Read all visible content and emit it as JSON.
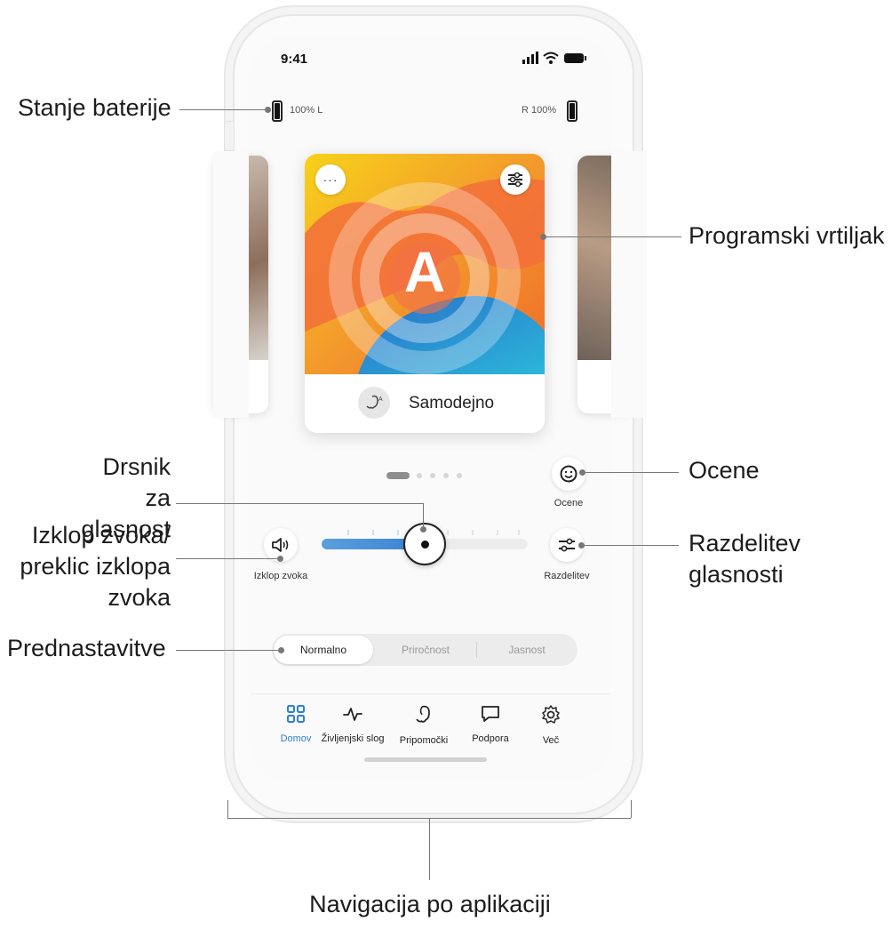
{
  "annotations": {
    "battery": "Stanje baterije",
    "carousel": "Programski vrtiljak",
    "ratings": "Ocene",
    "volume_slider": [
      "Drsnik za",
      "glasnost"
    ],
    "mute": [
      "Izklop zvoka/",
      "preklic izklopa",
      "zvoka"
    ],
    "split": [
      "Razdelitev",
      "glasnosti"
    ],
    "presets": "Prednastavitve",
    "navigation": "Navigacija po aplikaciji"
  },
  "status_bar": {
    "time": "9:41"
  },
  "battery": {
    "left_label": "100% L",
    "right_label": "R 100%"
  },
  "program": {
    "card_letter": "A",
    "name": "Samodejno",
    "page_count": 5,
    "active_page": 1
  },
  "controls": {
    "ratings_label": "Ocene",
    "mute_label": "Izklop zvoka",
    "split_label": "Razdelitev",
    "volume_level": 0.5
  },
  "presets": {
    "items": [
      "Normalno",
      "Priročnost",
      "Jasnost"
    ],
    "selected": "Normalno"
  },
  "nav": {
    "items": [
      {
        "label": "Domov",
        "icon": "grid-icon",
        "active": true
      },
      {
        "label": "Življenjski slog",
        "icon": "activity-icon",
        "active": false
      },
      {
        "label": "Pripomočki",
        "icon": "hearing-aid-icon",
        "active": false
      },
      {
        "label": "Podpora",
        "icon": "chat-icon",
        "active": false
      },
      {
        "label": "Več",
        "icon": "gear-icon",
        "active": false
      }
    ]
  },
  "colors": {
    "accent": "#2f7fd1",
    "slider_fill": "#3d8ad4"
  }
}
